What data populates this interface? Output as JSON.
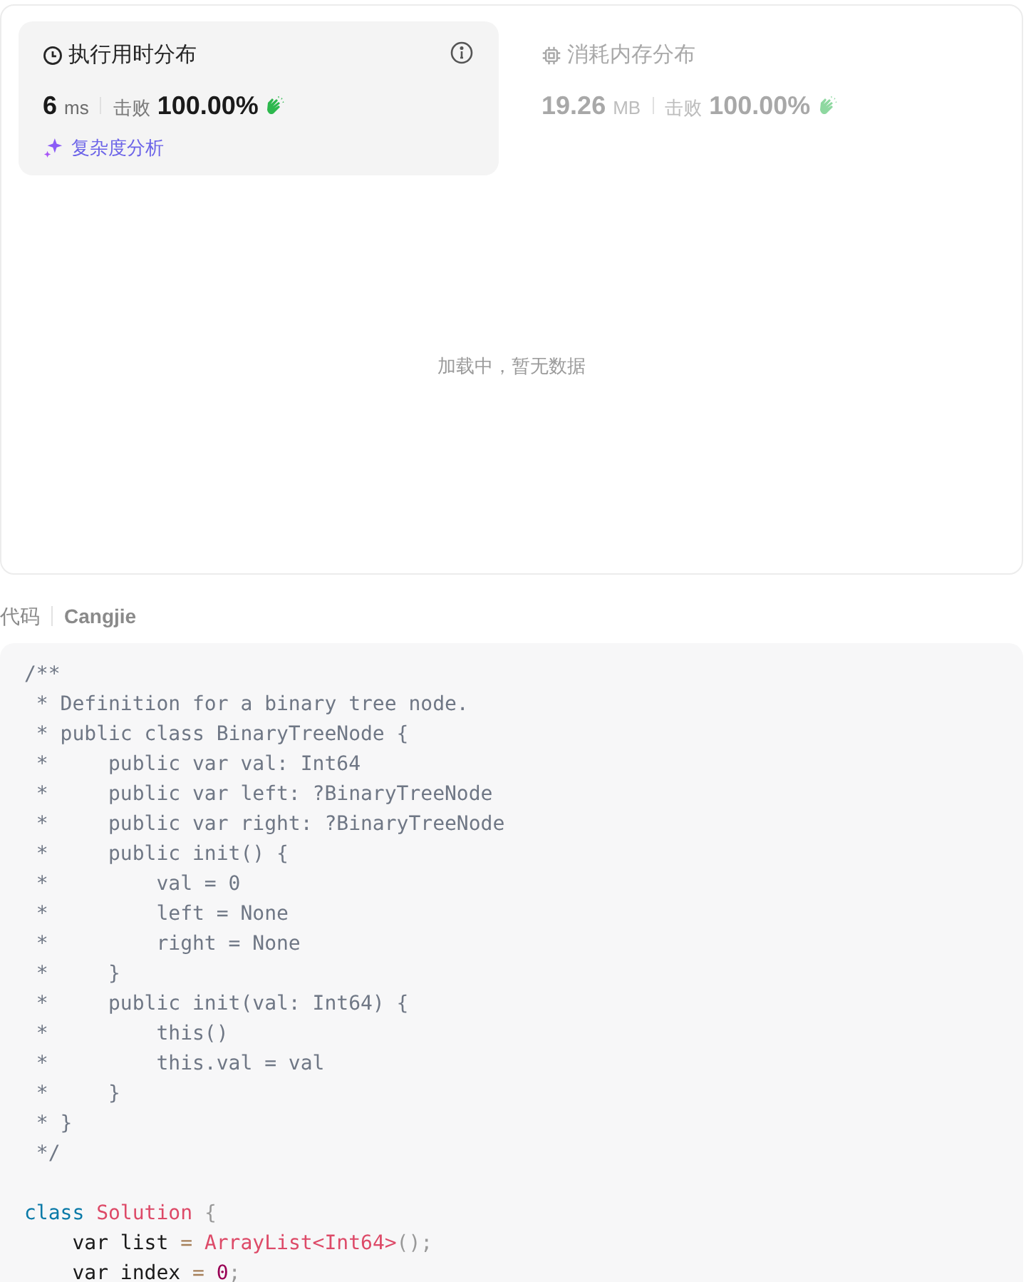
{
  "stats_cards": [
    {
      "kind": "runtime",
      "selected": true,
      "title": "执行用时分布",
      "value": "6",
      "unit": "ms",
      "beats_label": "击败",
      "percent": "100.00%",
      "link": "复杂度分析"
    },
    {
      "kind": "memory",
      "selected": false,
      "title": "消耗内存分布",
      "value": "19.26",
      "unit": "MB",
      "beats_label": "击败",
      "percent": "100.00%"
    }
  ],
  "chart_message": "加载中，暂无数据",
  "code_header": {
    "label": "代码",
    "language": "Cangjie"
  },
  "code_sections": [
    {
      "lines": [
        [
          {
            "kind": "comment",
            "text": "/**"
          }
        ],
        [
          {
            "kind": "comment",
            "text": " * Definition for a binary tree node."
          }
        ],
        [
          {
            "kind": "comment",
            "text": " * public class BinaryTreeNode {"
          }
        ],
        [
          {
            "kind": "comment",
            "text": " *     public var val: Int64"
          }
        ],
        [
          {
            "kind": "comment",
            "text": " *     public var left: ?BinaryTreeNode"
          }
        ],
        [
          {
            "kind": "comment",
            "text": " *     public var right: ?BinaryTreeNode"
          }
        ],
        [
          {
            "kind": "comment",
            "text": " *     public init() {"
          }
        ],
        [
          {
            "kind": "comment",
            "text": " *         val = 0"
          }
        ],
        [
          {
            "kind": "comment",
            "text": " *         left = None"
          }
        ],
        [
          {
            "kind": "comment",
            "text": " *         right = None"
          }
        ],
        [
          {
            "kind": "comment",
            "text": " *     }"
          }
        ],
        [
          {
            "kind": "comment",
            "text": " *     public init(val: Int64) {"
          }
        ],
        [
          {
            "kind": "comment",
            "text": " *         this()"
          }
        ],
        [
          {
            "kind": "comment",
            "text": " *         this.val = val"
          }
        ],
        [
          {
            "kind": "comment",
            "text": " *     }"
          }
        ],
        [
          {
            "kind": "comment",
            "text": " * }"
          }
        ],
        [
          {
            "kind": "comment",
            "text": " */"
          }
        ]
      ]
    },
    {
      "lines": [
        [
          {
            "kind": "keyword",
            "text": "class "
          },
          {
            "kind": "type",
            "text": "Solution "
          },
          {
            "kind": "punct",
            "text": "{"
          }
        ],
        [
          {
            "kind": "plain",
            "text": "    var list "
          },
          {
            "kind": "operator",
            "text": "= "
          },
          {
            "kind": "type",
            "text": "ArrayList<Int64>"
          },
          {
            "kind": "punct",
            "text": "();"
          }
        ],
        [
          {
            "kind": "plain",
            "text": "    var index "
          },
          {
            "kind": "operator",
            "text": "= "
          },
          {
            "kind": "number",
            "text": "0"
          },
          {
            "kind": "punct",
            "text": ";"
          }
        ]
      ]
    }
  ]
}
